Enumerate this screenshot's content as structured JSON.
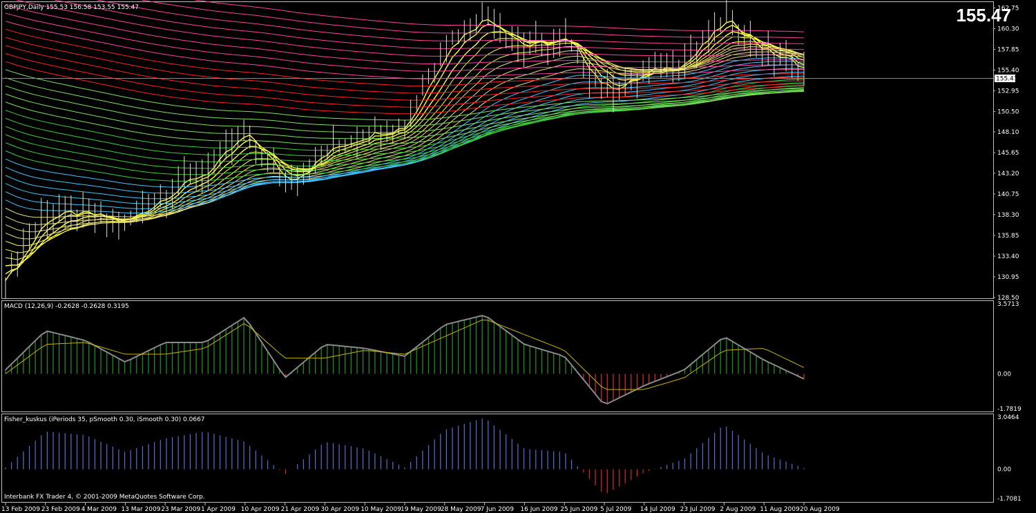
{
  "header": {
    "symbol_info": "GBPJPY,Daily  155.53 156.58 153.55 155.47",
    "last_price": "155.47",
    "footer": "Interbank FX Trader 4, © 2001-2009 MetaQuotes Software Corp."
  },
  "colors": {
    "background": "#000000",
    "frame": "#c0c0c0",
    "text": "#ffffff",
    "candle": "#e6e6c8",
    "macd_pos": "#1e8c1e",
    "macd_neg": "#d22828",
    "macd_line": "#8a8a8a",
    "signal_line": "#c8b400",
    "fisher_pos": "#5a6ed2",
    "fisher_neg": "#dc2828"
  },
  "chart_data": [
    {
      "type": "line",
      "id": "price",
      "title": "GBPJPY,Daily  155.53 156.58 153.55 155.47",
      "ylim": [
        128.5,
        163.2
      ],
      "yticks": [
        "162.75",
        "160.30",
        "157.85",
        "155.40",
        "152.95",
        "150.50",
        "148.10",
        "145.65",
        "143.20",
        "140.75",
        "138.30",
        "135.85",
        "133.40",
        "130.95",
        "128.50"
      ],
      "current_price": 155.47,
      "current_price_label": "155.47",
      "x_dates": [
        "13 Feb 2009",
        "23 Feb 2009",
        "4 Mar 2009",
        "13 Mar 2009",
        "23 Mar 2009",
        "1 Apr 2009",
        "10 Apr 2009",
        "21 Apr 2009",
        "30 Apr 2009",
        "10 May 2009",
        "19 May 2009",
        "28 May 2009",
        "7 Jun 2009",
        "16 Jun 2009",
        "25 Jun 2009",
        "5 Jul 2009",
        "14 Jul 2009",
        "23 Jul 2009",
        "2 Aug 2009",
        "11 Aug 2009",
        "20 Aug 2009"
      ],
      "close_by_date": [
        130.8,
        138.5,
        138.2,
        137.3,
        141.0,
        143.5,
        148.0,
        142.0,
        145.8,
        148.0,
        149.0,
        158.5,
        162.0,
        158.0,
        159.0,
        152.8,
        155.0,
        156.5,
        161.5,
        157.5,
        155.47
      ]
    },
    {
      "type": "bar",
      "id": "macd",
      "title": "MACD (12,26,9) -0.2628 -0.2628 0.3195",
      "ylim": [
        -1.7819,
        3.5713
      ],
      "yticks": [
        "3.5713",
        "0.00",
        "-1.7819"
      ],
      "macd_by_date": [
        0.2,
        2.2,
        1.7,
        0.6,
        1.6,
        1.6,
        2.9,
        -0.2,
        1.5,
        1.3,
        0.9,
        2.5,
        3.0,
        1.5,
        0.9,
        -1.6,
        -0.6,
        0.2,
        1.9,
        0.7,
        -0.26
      ],
      "signal_by_date": [
        0.0,
        1.5,
        1.6,
        1.0,
        1.0,
        1.3,
        2.6,
        0.8,
        0.8,
        1.2,
        1.0,
        1.9,
        2.8,
        2.0,
        1.2,
        -0.8,
        -0.8,
        -0.2,
        1.2,
        1.3,
        0.32
      ]
    },
    {
      "type": "bar",
      "id": "fisher",
      "title": "Fisher_kuskus  (iPeriods 35, pSmooth 0.30, iSmooth 0.30)  0.0667",
      "ylim": [
        -1.7081,
        3.0464
      ],
      "yticks": [
        "3.0464",
        "0.00",
        "-1.7081"
      ],
      "fisher_by_date": [
        0.1,
        2.2,
        2.0,
        1.0,
        1.8,
        2.2,
        1.6,
        -0.3,
        1.6,
        1.2,
        0.1,
        2.3,
        3.0,
        1.2,
        1.0,
        -1.5,
        -0.2,
        0.6,
        2.6,
        0.9,
        0.07
      ]
    }
  ]
}
